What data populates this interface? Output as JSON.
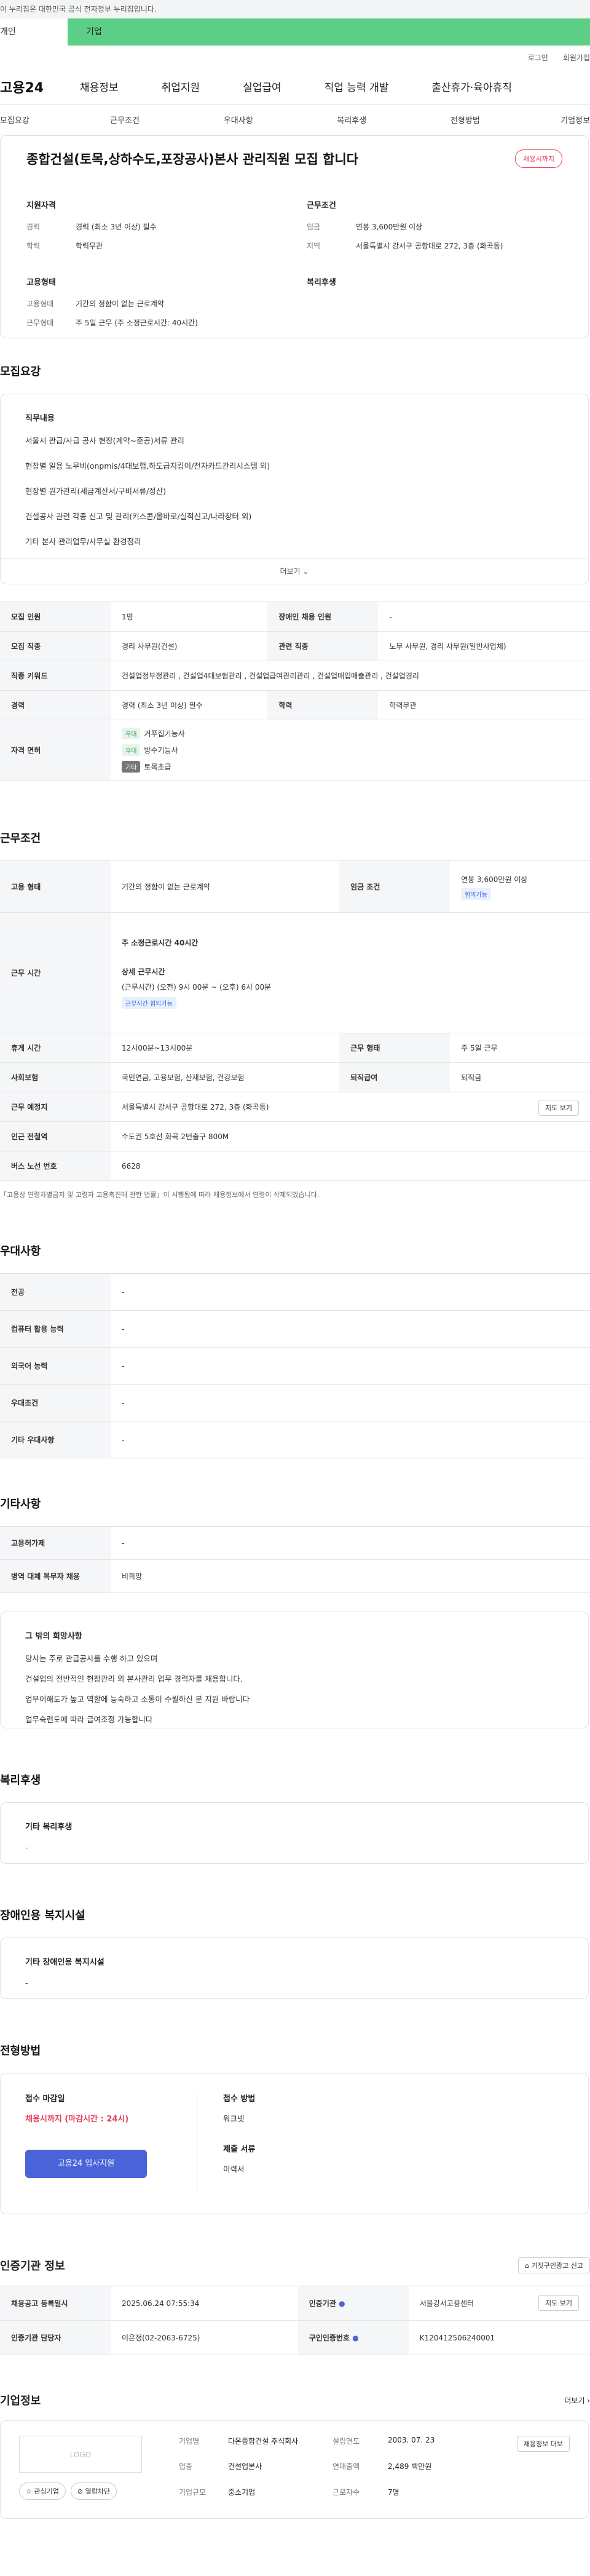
{
  "gov_bar": "이 누리집은 대한민국 공식 전자정부 누리집입니다.",
  "member_tabs": [
    "개인",
    "기업"
  ],
  "util": [
    "로그인",
    "회원가입"
  ],
  "brand": "고용24",
  "gnb": [
    "채용정보",
    "취업지원",
    "실업급여",
    "직업 능력 개발",
    "출산휴가·육아휴직"
  ],
  "snb": [
    "모집요강",
    "근무조건",
    "우대사항",
    "복리후생",
    "전형방법",
    "기업정보"
  ],
  "summary": {
    "title": "종합건설(토목,상하수도,포장공사)본사 관리직원 모집 합니다",
    "badge": "채용시까지",
    "qual_title": "지원자격",
    "qual": [
      {
        "k": "경력",
        "v": "경력 (최소 3년 이상) 필수"
      },
      {
        "k": "학력",
        "v": "학력무관"
      }
    ],
    "cond_title": "근무조건",
    "cond": [
      {
        "k": "임금",
        "v": "연봉 3,600만원 이상"
      },
      {
        "k": "지역",
        "v": "서울특별시 강서구 공항대로 272, 3층 (화곡동)"
      }
    ],
    "emp_title": "고용형태",
    "emp": [
      {
        "k": "고용형태",
        "v": "기간의 정함이 없는 근로계약"
      },
      {
        "k": "근무형태",
        "v": "주 5일 근무 (주 소정근로시간: 40시간)"
      }
    ],
    "welfare_title": "복리후생"
  },
  "recruit": {
    "heading": "모집요강",
    "duty_title": "직무내용",
    "duties": [
      "서울시 관급/사급 공사 현장(계약~준공)서류 관리",
      "현장별 일용 노무비(onpmis/4대보험,하도급지킴이/전자카드관리시스템 외)",
      "현장별 원가관리(세금계산서/구비서류/정산)",
      "건설공사 관련 각종 신고 및 관리(키스콘/올바로/실적신고/나라장터 외)",
      "기타 본사 관리업무/사무실 환경정리"
    ],
    "more": "더보기",
    "rows": {
      "count_k": "모집 인원",
      "count_v": "1명",
      "disabled_k": "장애인 채용 인원",
      "disabled_v": "-",
      "job_k": "모집 직종",
      "job_v": "경리 사무원(건설)",
      "rel_k": "관련 직종",
      "rel_v": "노무 사무원, 경리 사무원(일반사업체)",
      "kw_k": "직종 키워드",
      "kw_v": "건설업정부정관리 , 건설업4대보험관리 , 건설업급여관리관리 , 건설업매입매출관리 , 건설업경리",
      "career_k": "경력",
      "career_v": "경력 (최소 3년 이상) 필수",
      "edu_k": "학력",
      "edu_v": "학력무관",
      "license_k": "자격 면허",
      "licenses": [
        {
          "tag": "우대",
          "name": "거푸집기능사"
        },
        {
          "tag": "우대",
          "name": "방수기능사"
        },
        {
          "tag": "기타",
          "name": "토목초급"
        }
      ]
    }
  },
  "work": {
    "heading": "근무조건",
    "type_k": "고용 형태",
    "type_v": "기간의 정함이 없는 근로계약",
    "wage_k": "임금 조건",
    "wage_v": "연봉 3,600만원 이상",
    "wage_tag": "협의가능",
    "hours_k": "근무 시간",
    "hours_main": "주 소정근로시간 40시간",
    "hours_detail_title": "상세 근무시간",
    "hours_detail": "(근무시간) (오전) 9시 00분 ~ (오후) 6시 00분",
    "hours_tag": "근무시간 협의가능",
    "break_k": "휴게 시간",
    "break_v": "12시00분~13시00분",
    "shift_k": "근무 형태",
    "shift_v": "주 5일 근무",
    "ins_k": "사회보험",
    "ins_v": "국민연금, 고용보험, 산재보험, 건강보험",
    "ret_k": "퇴직급여",
    "ret_v": "퇴직금",
    "place_k": "근무 예정지",
    "place_v": "서울특별시 강서구 공항대로 272, 3층 (화곡동)",
    "map_btn": "지도 보기",
    "subway_k": "인근 전철역",
    "subway_v": "수도권 5호선 화곡 2번출구 800M",
    "bus_k": "버스 노선 번호",
    "bus_v": "6628",
    "note": "「고용상 연령차별금지 및 고령자 고용촉진에 관한 법률」이 시행됨에 따라 채용정보에서 연령이 삭제되었습니다."
  },
  "prefer": {
    "heading": "우대사항",
    "rows": [
      {
        "k": "전공",
        "v": "-"
      },
      {
        "k": "컴퓨터 활용 능력",
        "v": "-"
      },
      {
        "k": "외국어 능력",
        "v": "-"
      },
      {
        "k": "우대조건",
        "v": "-"
      },
      {
        "k": "기타 우대사항",
        "v": "-"
      }
    ]
  },
  "etc": {
    "heading": "기타사항",
    "rows": [
      {
        "k": "고용허가제",
        "v": "-"
      },
      {
        "k": "병역 대체 복무자 채용",
        "v": "비희망"
      }
    ],
    "wish_title": "그 밖의 희망사항",
    "wish_lines": [
      "당사는 주로 관급공사를 수행 하고 있으며",
      "건설업의 전반적인 현장관리 외 본사관리 업무 경력자를 채용합니다.",
      "업무이해도가 높고 역할에 능숙하고 소통이 수월하신 분 지원 바랍니다",
      "업무숙련도에 따라 급여조정 가능합니다"
    ]
  },
  "welfare": {
    "heading": "복리후생",
    "title": "기타 복리후생",
    "value": "-"
  },
  "disabled": {
    "heading": "장애인용 복지시설",
    "title": "기타 장애인용 복지시설",
    "value": "-"
  },
  "screening": {
    "heading": "전형방법",
    "deadline_label": "접수 마감일",
    "deadline_value": "채용시까지 (마감시간 : 24시)",
    "apply_btn": "고용24 입사지원",
    "method_label": "접수 방법",
    "method_value": "워크넷",
    "docs_label": "제출 서류",
    "docs_value": "이력서"
  },
  "cert": {
    "heading": "인증기관 정보",
    "report_btn": "거짓구인광고 신고",
    "reg_k": "채용공고 등록일시",
    "reg_v": "2025.06.24 07:55:34",
    "org_k": "인증기관",
    "org_v": "서울강서고용센터",
    "map_btn": "지도 보기",
    "mgr_k": "인증기관 담당자",
    "mgr_v": "이은정(02-2063-6725)",
    "no_k": "구인인증번호",
    "no_v": "K120412506240001"
  },
  "company": {
    "heading": "기업정보",
    "more": "더보기",
    "logo": "LOGO",
    "fav_btn": "관심기업",
    "block_btn": "열람차단",
    "name_k": "기업명",
    "name_v": "다온종합건설 주식회사",
    "industry_k": "업종",
    "industry_v": "건설업본사",
    "scale_k": "기업규모",
    "scale_v": "중소기업",
    "founded_k": "설립연도",
    "founded_v": "2003. 07. 23",
    "sales_k": "연매출액",
    "sales_v": "2,489 백만원",
    "staff_k": "근로자수",
    "staff_v": "7명",
    "job_btn": "채용정보 더보"
  }
}
